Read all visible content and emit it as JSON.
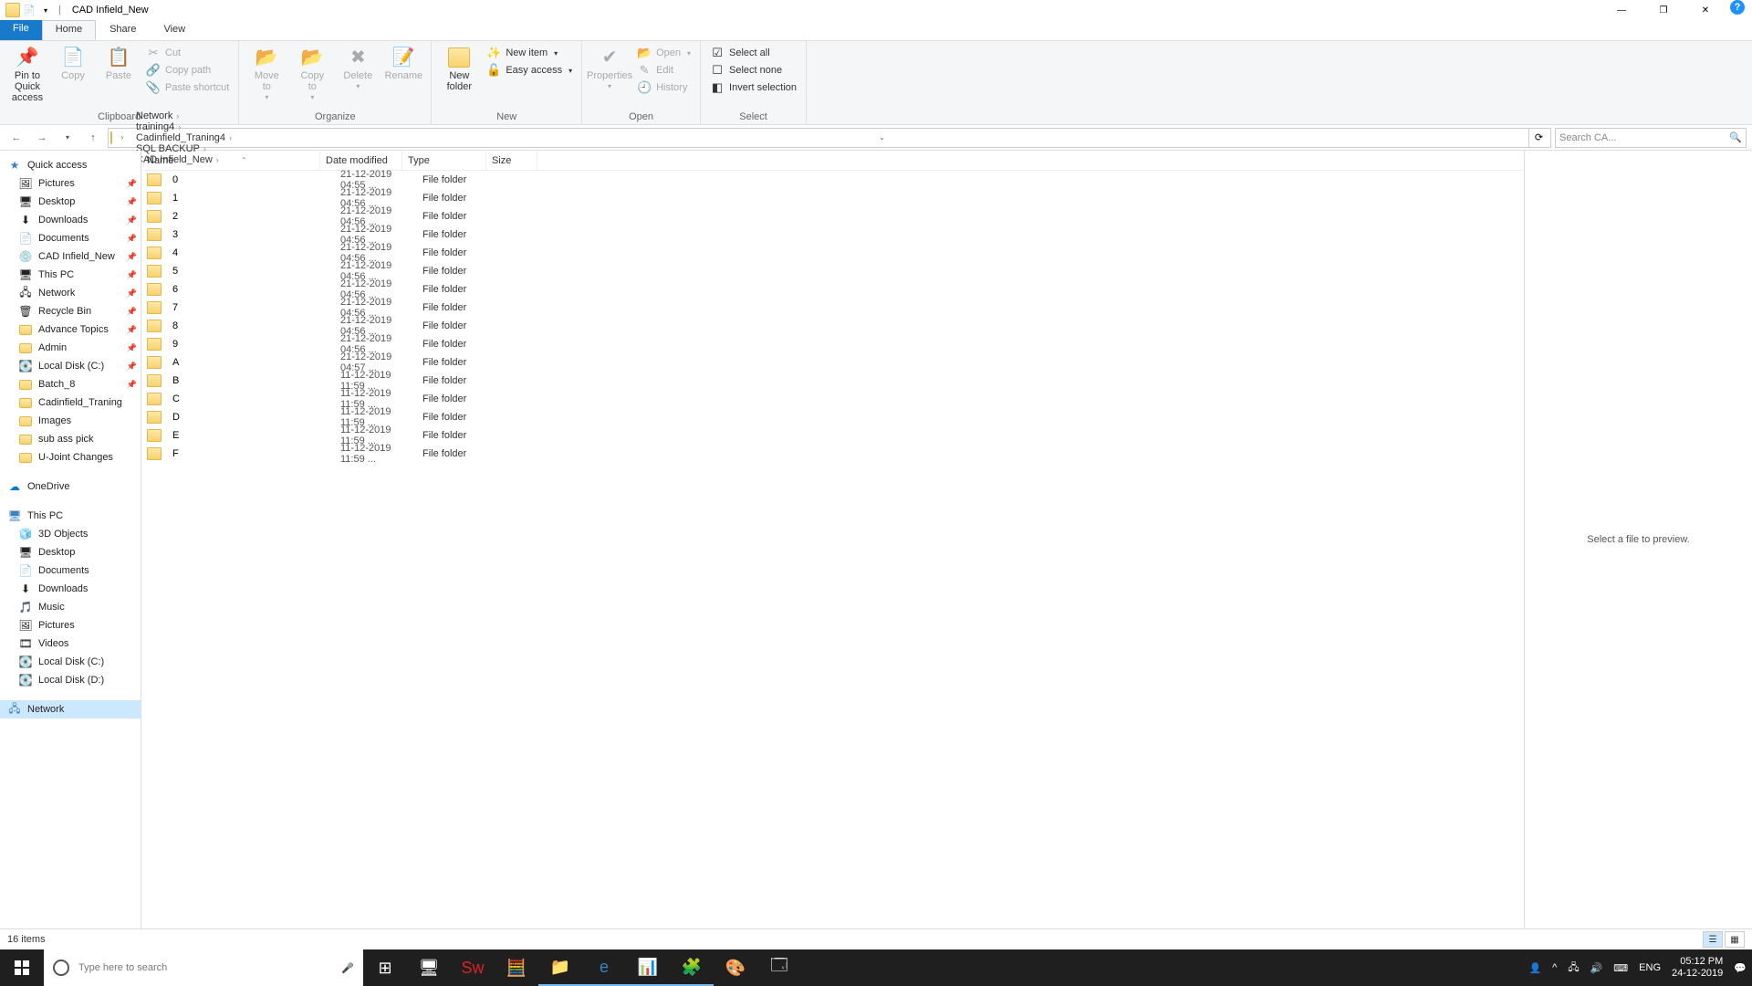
{
  "title": "CAD Infield_New",
  "tabs": {
    "file": "File",
    "home": "Home",
    "share": "Share",
    "view": "View"
  },
  "ribbon": {
    "clipboard": {
      "pin": "Pin to Quick\naccess",
      "copy": "Copy",
      "paste": "Paste",
      "cut": "Cut",
      "copypath": "Copy path",
      "pasteshortcut": "Paste shortcut",
      "label": "Clipboard"
    },
    "organize": {
      "moveto": "Move\nto",
      "copyto": "Copy\nto",
      "delete": "Delete",
      "rename": "Rename",
      "label": "Organize"
    },
    "new": {
      "newfolder": "New\nfolder",
      "newitem": "New item",
      "easyaccess": "Easy access",
      "label": "New"
    },
    "open": {
      "properties": "Properties",
      "open": "Open",
      "edit": "Edit",
      "history": "History",
      "label": "Open"
    },
    "select": {
      "selectall": "Select all",
      "selectnone": "Select none",
      "invert": "Invert selection",
      "label": "Select"
    }
  },
  "breadcrumbs": [
    "Network",
    "training4",
    "Cadinfield_Traning4",
    "SQL BACKUP",
    "CAD Infield_New"
  ],
  "search_placeholder": "Search CA...",
  "columns": {
    "name": "Name",
    "date": "Date modified",
    "type": "Type",
    "size": "Size"
  },
  "files": [
    {
      "name": "0",
      "date": "21-12-2019 04:55 ...",
      "type": "File folder"
    },
    {
      "name": "1",
      "date": "21-12-2019 04:56 ...",
      "type": "File folder"
    },
    {
      "name": "2",
      "date": "21-12-2019 04:56 ...",
      "type": "File folder"
    },
    {
      "name": "3",
      "date": "21-12-2019 04:56 ...",
      "type": "File folder"
    },
    {
      "name": "4",
      "date": "21-12-2019 04:56 ...",
      "type": "File folder"
    },
    {
      "name": "5",
      "date": "21-12-2019 04:56 ...",
      "type": "File folder"
    },
    {
      "name": "6",
      "date": "21-12-2019 04:56 ...",
      "type": "File folder"
    },
    {
      "name": "7",
      "date": "21-12-2019 04:56 ...",
      "type": "File folder"
    },
    {
      "name": "8",
      "date": "21-12-2019 04:56 ...",
      "type": "File folder"
    },
    {
      "name": "9",
      "date": "21-12-2019 04:56 ...",
      "type": "File folder"
    },
    {
      "name": "A",
      "date": "21-12-2019 04:57 ...",
      "type": "File folder"
    },
    {
      "name": "B",
      "date": "11-12-2019 11:59 ...",
      "type": "File folder"
    },
    {
      "name": "C",
      "date": "11-12-2019 11:59 ...",
      "type": "File folder"
    },
    {
      "name": "D",
      "date": "11-12-2019 11:59 ...",
      "type": "File folder"
    },
    {
      "name": "E",
      "date": "11-12-2019 11:59 ...",
      "type": "File folder"
    },
    {
      "name": "F",
      "date": "11-12-2019 11:59 ...",
      "type": "File folder"
    }
  ],
  "nav": {
    "quickaccess": "Quick access",
    "items1": [
      "Pictures",
      "Desktop",
      "Downloads",
      "Documents",
      "CAD Infield_New",
      "This PC",
      "Network",
      "Recycle Bin",
      "Advance Topics",
      "Admin",
      "Local Disk (C:)",
      "Batch_8",
      "Cadinfield_Traning",
      "Images",
      "sub ass pick",
      "U-Joint Changes"
    ],
    "onedrive": "OneDrive",
    "thispc": "This PC",
    "items2": [
      "3D Objects",
      "Desktop",
      "Documents",
      "Downloads",
      "Music",
      "Pictures",
      "Videos",
      "Local Disk (C:)",
      "Local Disk (D:)"
    ],
    "network": "Network"
  },
  "preview_text": "Select a file to preview.",
  "status": "16 items",
  "taskbar": {
    "search_placeholder": "Type here to search",
    "lang": "ENG",
    "time": "05:12 PM",
    "date": "24-12-2019"
  }
}
